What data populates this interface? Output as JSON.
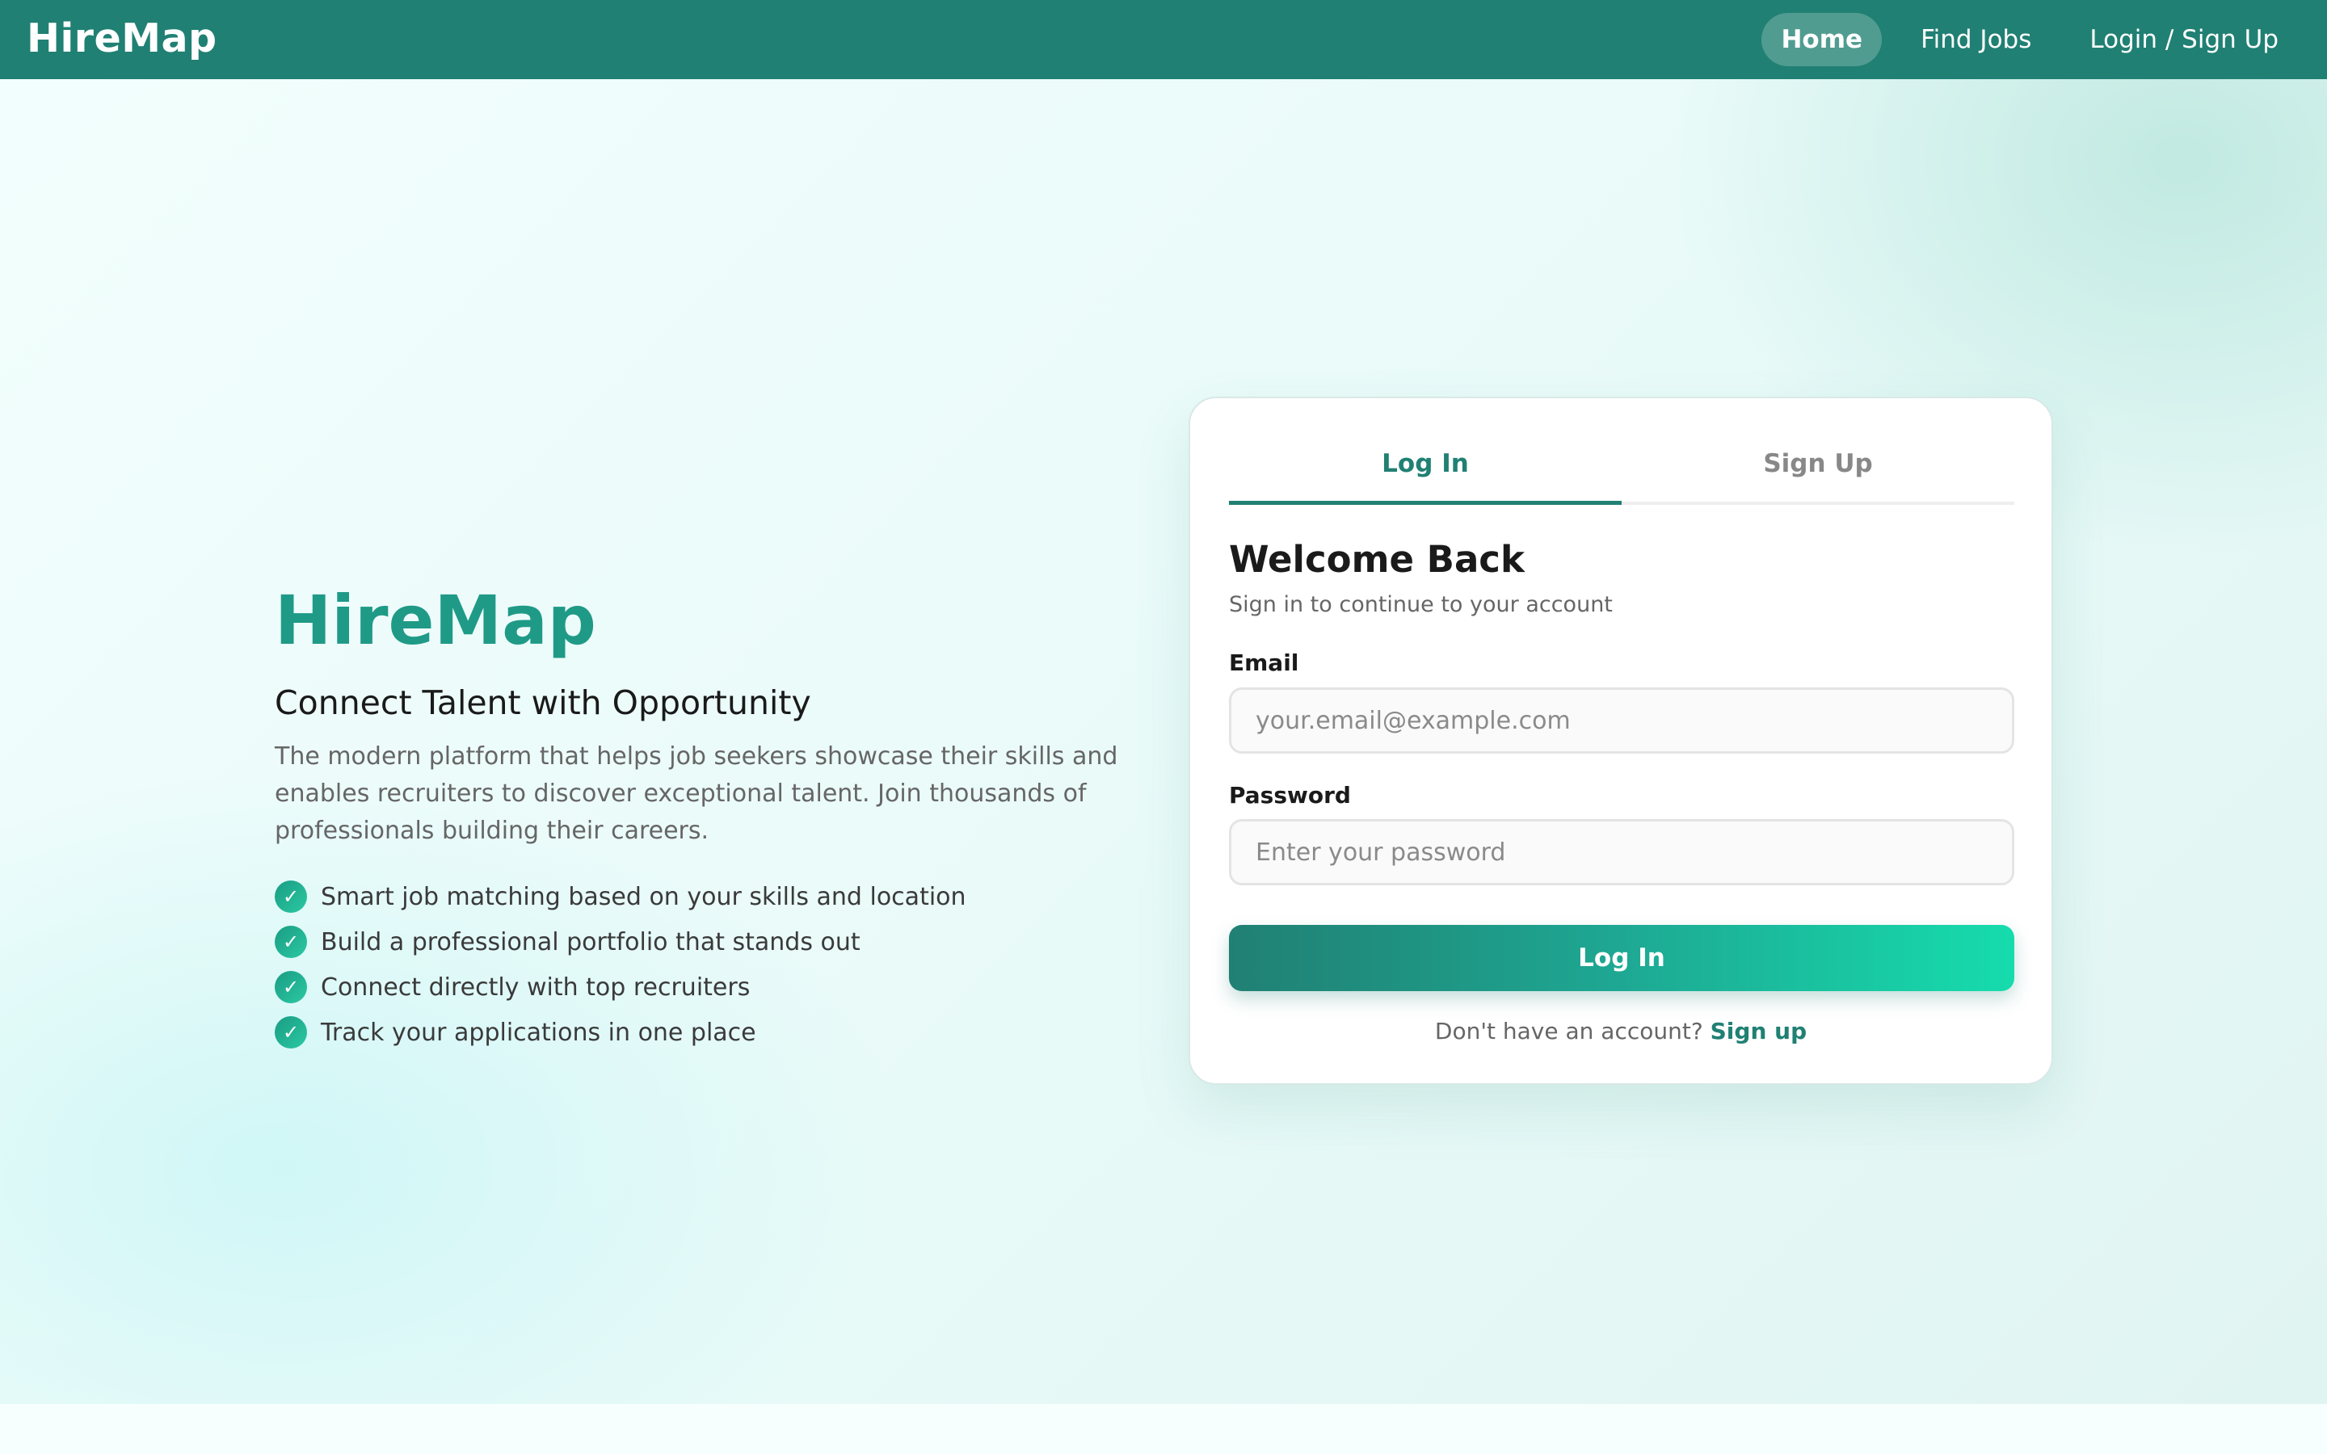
{
  "navbar": {
    "brand": "HireMap",
    "links": [
      {
        "label": "Home",
        "active": true
      },
      {
        "label": "Find Jobs",
        "active": false
      },
      {
        "label": "Login / Sign Up",
        "active": false
      }
    ]
  },
  "hero": {
    "title": "HireMap",
    "subtitle": "Connect Talent with Opportunity",
    "description": "The modern platform that helps job seekers showcase their skills and enables recruiters to discover exceptional talent. Join thousands of professionals building their careers.",
    "features": [
      "Smart job matching based on your skills and location",
      "Build a professional portfolio that stands out",
      "Connect directly with top recruiters",
      "Track your applications in one place"
    ],
    "check_glyph": "✓"
  },
  "auth_card": {
    "tabs": [
      {
        "label": "Log In",
        "active": true
      },
      {
        "label": "Sign Up",
        "active": false
      }
    ],
    "title": "Welcome Back",
    "subtitle": "Sign in to continue to your account",
    "email": {
      "label": "Email",
      "placeholder": "your.email@example.com",
      "value": ""
    },
    "password": {
      "label": "Password",
      "placeholder": "Enter your password",
      "value": ""
    },
    "submit_label": "Log In",
    "switch_text": "Don't have an account?",
    "switch_link": "Sign up"
  },
  "colors": {
    "primary": "#208073",
    "accent": "#1f9a87",
    "gradient_end": "#16dcad"
  }
}
